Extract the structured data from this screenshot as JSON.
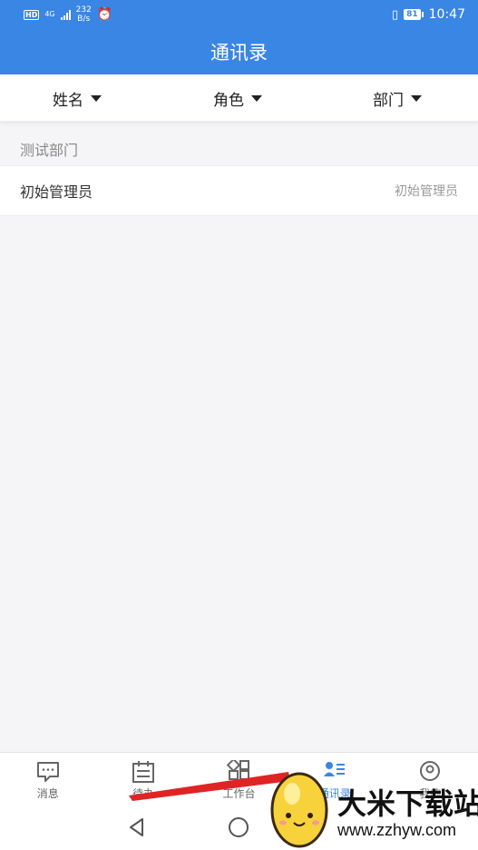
{
  "status_bar": {
    "hd": "HD",
    "network": "4G",
    "speed": "232\nB/s",
    "battery": "81",
    "time": "10:47"
  },
  "header": {
    "title": "通讯录"
  },
  "filters": [
    {
      "label": "姓名"
    },
    {
      "label": "角色"
    },
    {
      "label": "部门"
    }
  ],
  "group": {
    "name": "测试部门"
  },
  "contacts": [
    {
      "name": "初始管理员",
      "role": "初始管理员"
    }
  ],
  "bottom_nav": [
    {
      "label": "消息",
      "icon": "message-icon"
    },
    {
      "label": "待办",
      "icon": "calendar-icon"
    },
    {
      "label": "工作台",
      "icon": "grid-icon"
    },
    {
      "label": "通讯录",
      "icon": "contacts-icon",
      "active": true
    },
    {
      "label": "我的",
      "icon": "profile-icon"
    }
  ],
  "watermark": {
    "brand": "大米下载站",
    "url": "www.zzhyw.com"
  },
  "colors": {
    "primary": "#3a86e4",
    "background": "#f5f5f7",
    "annotation": "#e02424"
  }
}
